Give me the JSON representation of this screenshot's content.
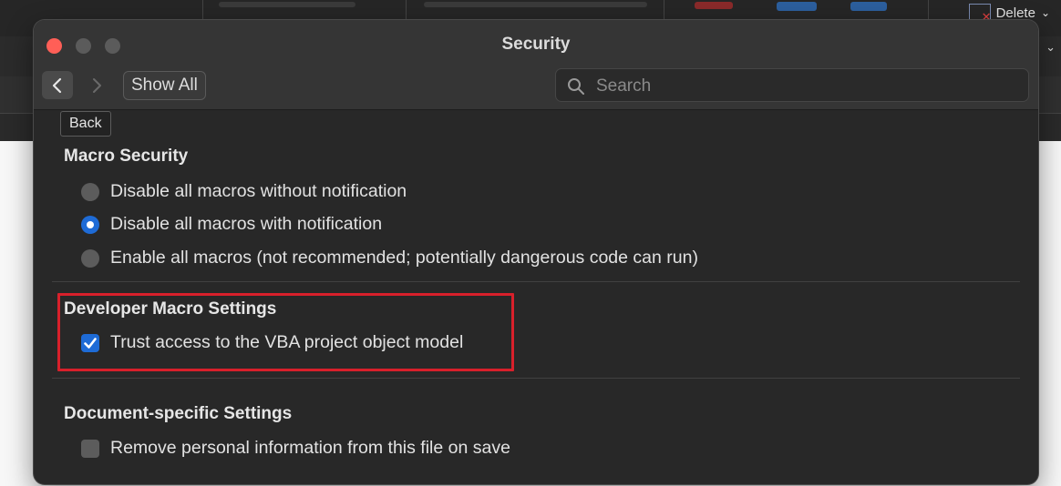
{
  "background_app": {
    "delete_label": "Delete"
  },
  "dialog": {
    "title": "Security",
    "toolbar": {
      "show_all_label": "Show All",
      "search_placeholder": "Search",
      "back_tooltip": "Back"
    },
    "sections": {
      "macro_security": {
        "title": "Macro Security",
        "options": [
          {
            "label": "Disable all macros without notification",
            "selected": false
          },
          {
            "label": "Disable all macros with notification",
            "selected": true
          },
          {
            "label": "Enable all macros (not recommended; potentially dangerous code can run)",
            "selected": false
          }
        ]
      },
      "developer_macro": {
        "title": "Developer Macro Settings",
        "trust_vba_label": "Trust access to the VBA project object model",
        "trust_vba_checked": true
      },
      "document_specific": {
        "title": "Document-specific Settings",
        "remove_personal_label": "Remove personal information from this file on save",
        "remove_personal_checked": false
      }
    },
    "colors": {
      "accent": "#1e6bd6",
      "highlight_border": "#d8202b",
      "close_button": "#ff5f57"
    }
  }
}
